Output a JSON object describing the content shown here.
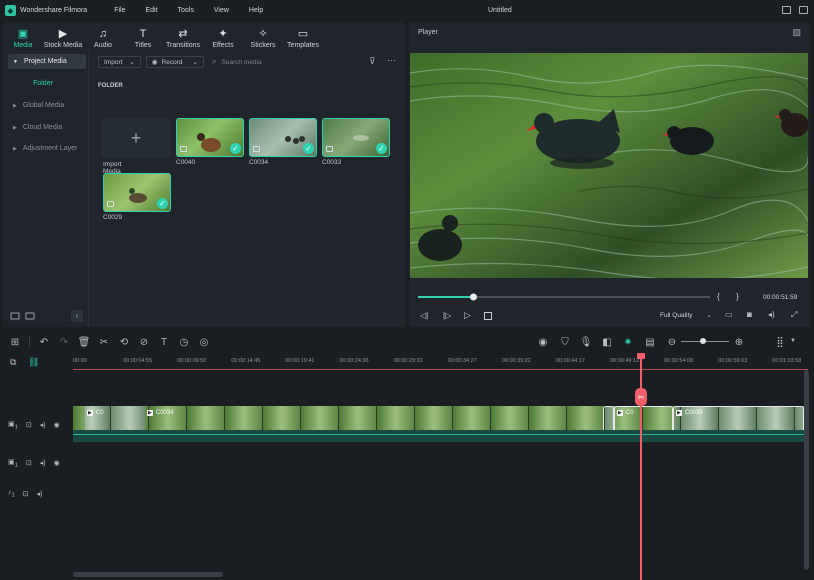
{
  "app": {
    "name": "Wondershare Filmora",
    "window_title": "Untitled"
  },
  "menu": [
    "File",
    "Edit",
    "Tools",
    "View",
    "Help"
  ],
  "toolbar": [
    {
      "label": "Media",
      "icon": "media-icon",
      "glyph": "▣",
      "active": true
    },
    {
      "label": "Stock Media",
      "icon": "stock-media-icon",
      "glyph": "▶",
      "active": false
    },
    {
      "label": "Audio",
      "icon": "audio-icon",
      "glyph": "♫",
      "active": false
    },
    {
      "label": "Titles",
      "icon": "titles-icon",
      "glyph": "T",
      "active": false
    },
    {
      "label": "Transitions",
      "icon": "transitions-icon",
      "glyph": "⇄",
      "active": false
    },
    {
      "label": "Effects",
      "icon": "effects-icon",
      "glyph": "✦",
      "active": false
    },
    {
      "label": "Stickers",
      "icon": "stickers-icon",
      "glyph": "✧",
      "active": false
    },
    {
      "label": "Templates",
      "icon": "templates-icon",
      "glyph": "▭",
      "active": false
    }
  ],
  "sidebar": {
    "project_media": "Project Media",
    "folder": "Folder",
    "items": [
      "Global Media",
      "Cloud Media",
      "Adjustment Layer"
    ]
  },
  "media_bar": {
    "import": "Import",
    "record": "Record",
    "search_placeholder": "Search media"
  },
  "library": {
    "section": "FOLDER",
    "import_label": "Import Media",
    "clips": [
      "C0040",
      "C0034",
      "C0033",
      "C0029"
    ]
  },
  "player": {
    "title": "Player",
    "progress": 0.19,
    "braces": [
      "{",
      "}"
    ],
    "timecode": "00:00:51:59",
    "quality": "Full Quality"
  },
  "timeline": {
    "ticks": [
      "00:00",
      "00:00:04:55",
      "00:00:09:50",
      "00:00:14:45",
      "00:00:19:41",
      "00:00:24:36",
      "00:00:29:31",
      "00:00:34:27",
      "00:00:39:22",
      "00:00:44:17",
      "00:00:49:12",
      "00:00:54:08",
      "00:00:59:03",
      "00:01:03:58"
    ],
    "clip_labels": [
      "C0",
      "C0034",
      "C0",
      "C0033"
    ],
    "tracks": [
      {
        "num": "1",
        "type": "video"
      },
      {
        "num": "1",
        "type": "video"
      },
      {
        "num": "1",
        "type": "audio"
      }
    ]
  },
  "colors": {
    "accent": "#2fd3b2",
    "playhead": "#f25f6b",
    "panel": "#20252b"
  }
}
